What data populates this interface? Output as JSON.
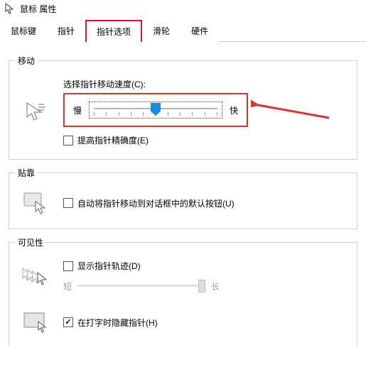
{
  "window": {
    "title": "鼠标 属性"
  },
  "tabs": {
    "items": [
      {
        "label": "鼠标键"
      },
      {
        "label": "指针"
      },
      {
        "label": "指针选项"
      },
      {
        "label": "滑轮"
      },
      {
        "label": "硬件"
      }
    ],
    "active_index": 2
  },
  "groups": {
    "movement": {
      "title": "移动",
      "speed_label": "选择指针移动速度(C):",
      "slow": "慢",
      "fast": "快",
      "slider_pos_pct": 50,
      "enhance_label": "提高指针精确度(E)",
      "enhance_checked": false
    },
    "snap": {
      "title": "贴靠",
      "snap_label": "自动将指针移动到对话框中的默认按钮(U)",
      "snap_checked": false
    },
    "visibility": {
      "title": "可见性",
      "trail_label": "显示指针轨迹(D)",
      "trail_checked": false,
      "trail_short": "短",
      "trail_long": "长",
      "trail_pos_pct": 100,
      "hide_typing_label": "在打字时隐藏指针(H)",
      "hide_typing_checked": true
    }
  }
}
